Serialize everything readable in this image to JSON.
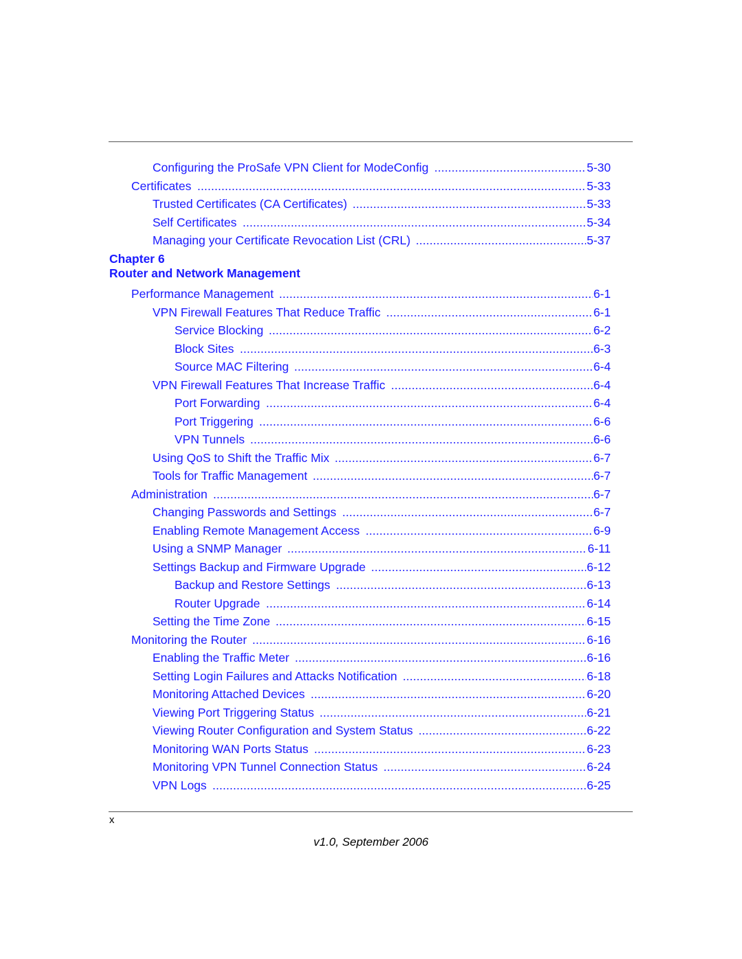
{
  "toc_continued": [
    {
      "level": 2,
      "title": "Configuring the ProSafe VPN Client for ModeConfig",
      "page": "5-30"
    },
    {
      "level": 1,
      "title": "Certificates",
      "page": "5-33"
    },
    {
      "level": 2,
      "title": "Trusted Certificates (CA Certificates)",
      "page": "5-33"
    },
    {
      "level": 2,
      "title": "Self Certificates",
      "page": "5-34"
    },
    {
      "level": 2,
      "title": "Managing your Certificate Revocation List (CRL)",
      "page": "5-37"
    }
  ],
  "chapter": {
    "label": "Chapter 6",
    "title": "Router and Network Management"
  },
  "toc_chapter": [
    {
      "level": 1,
      "title": "Performance Management",
      "page": "6-1"
    },
    {
      "level": 2,
      "title": "VPN Firewall Features That Reduce Traffic",
      "page": "6-1"
    },
    {
      "level": 3,
      "title": "Service Blocking",
      "page": "6-2"
    },
    {
      "level": 3,
      "title": "Block Sites",
      "page": "6-3"
    },
    {
      "level": 3,
      "title": "Source MAC Filtering",
      "page": "6-4"
    },
    {
      "level": 2,
      "title": "VPN Firewall Features That Increase Traffic",
      "page": "6-4"
    },
    {
      "level": 3,
      "title": "Port Forwarding",
      "page": "6-4"
    },
    {
      "level": 3,
      "title": "Port Triggering",
      "page": "6-6"
    },
    {
      "level": 3,
      "title": "VPN Tunnels",
      "page": "6-6"
    },
    {
      "level": 2,
      "title": "Using QoS to Shift the Traffic Mix",
      "page": "6-7"
    },
    {
      "level": 2,
      "title": "Tools for Traffic Management",
      "page": "6-7"
    },
    {
      "level": 1,
      "title": "Administration",
      "page": "6-7"
    },
    {
      "level": 2,
      "title": "Changing Passwords and Settings",
      "page": "6-7"
    },
    {
      "level": 2,
      "title": "Enabling Remote Management Access",
      "page": "6-9"
    },
    {
      "level": 2,
      "title": "Using a SNMP Manager",
      "page": "6-11"
    },
    {
      "level": 2,
      "title": "Settings Backup and Firmware Upgrade",
      "page": "6-12"
    },
    {
      "level": 3,
      "title": "Backup and Restore Settings",
      "page": "6-13"
    },
    {
      "level": 3,
      "title": "Router Upgrade",
      "page": "6-14"
    },
    {
      "level": 2,
      "title": "Setting the Time Zone",
      "page": "6-15"
    },
    {
      "level": 1,
      "title": "Monitoring the Router",
      "page": "6-16"
    },
    {
      "level": 2,
      "title": "Enabling the Traffic Meter",
      "page": "6-16"
    },
    {
      "level": 2,
      "title": "Setting Login Failures and Attacks Notification",
      "page": "6-18"
    },
    {
      "level": 2,
      "title": "Monitoring Attached Devices",
      "page": "6-20"
    },
    {
      "level": 2,
      "title": "Viewing Port Triggering Status",
      "page": "6-21"
    },
    {
      "level": 2,
      "title": "Viewing Router Configuration and System Status",
      "page": "6-22"
    },
    {
      "level": 2,
      "title": "Monitoring WAN Ports Status",
      "page": "6-23"
    },
    {
      "level": 2,
      "title": "Monitoring VPN Tunnel Connection Status",
      "page": "6-24"
    },
    {
      "level": 2,
      "title": "VPN Logs",
      "page": "6-25"
    }
  ],
  "footer": {
    "page_number": "x",
    "version": "v1.0, September 2006"
  },
  "colors": {
    "link": "#1a1aff",
    "rule": "#555555",
    "text": "#000000"
  }
}
